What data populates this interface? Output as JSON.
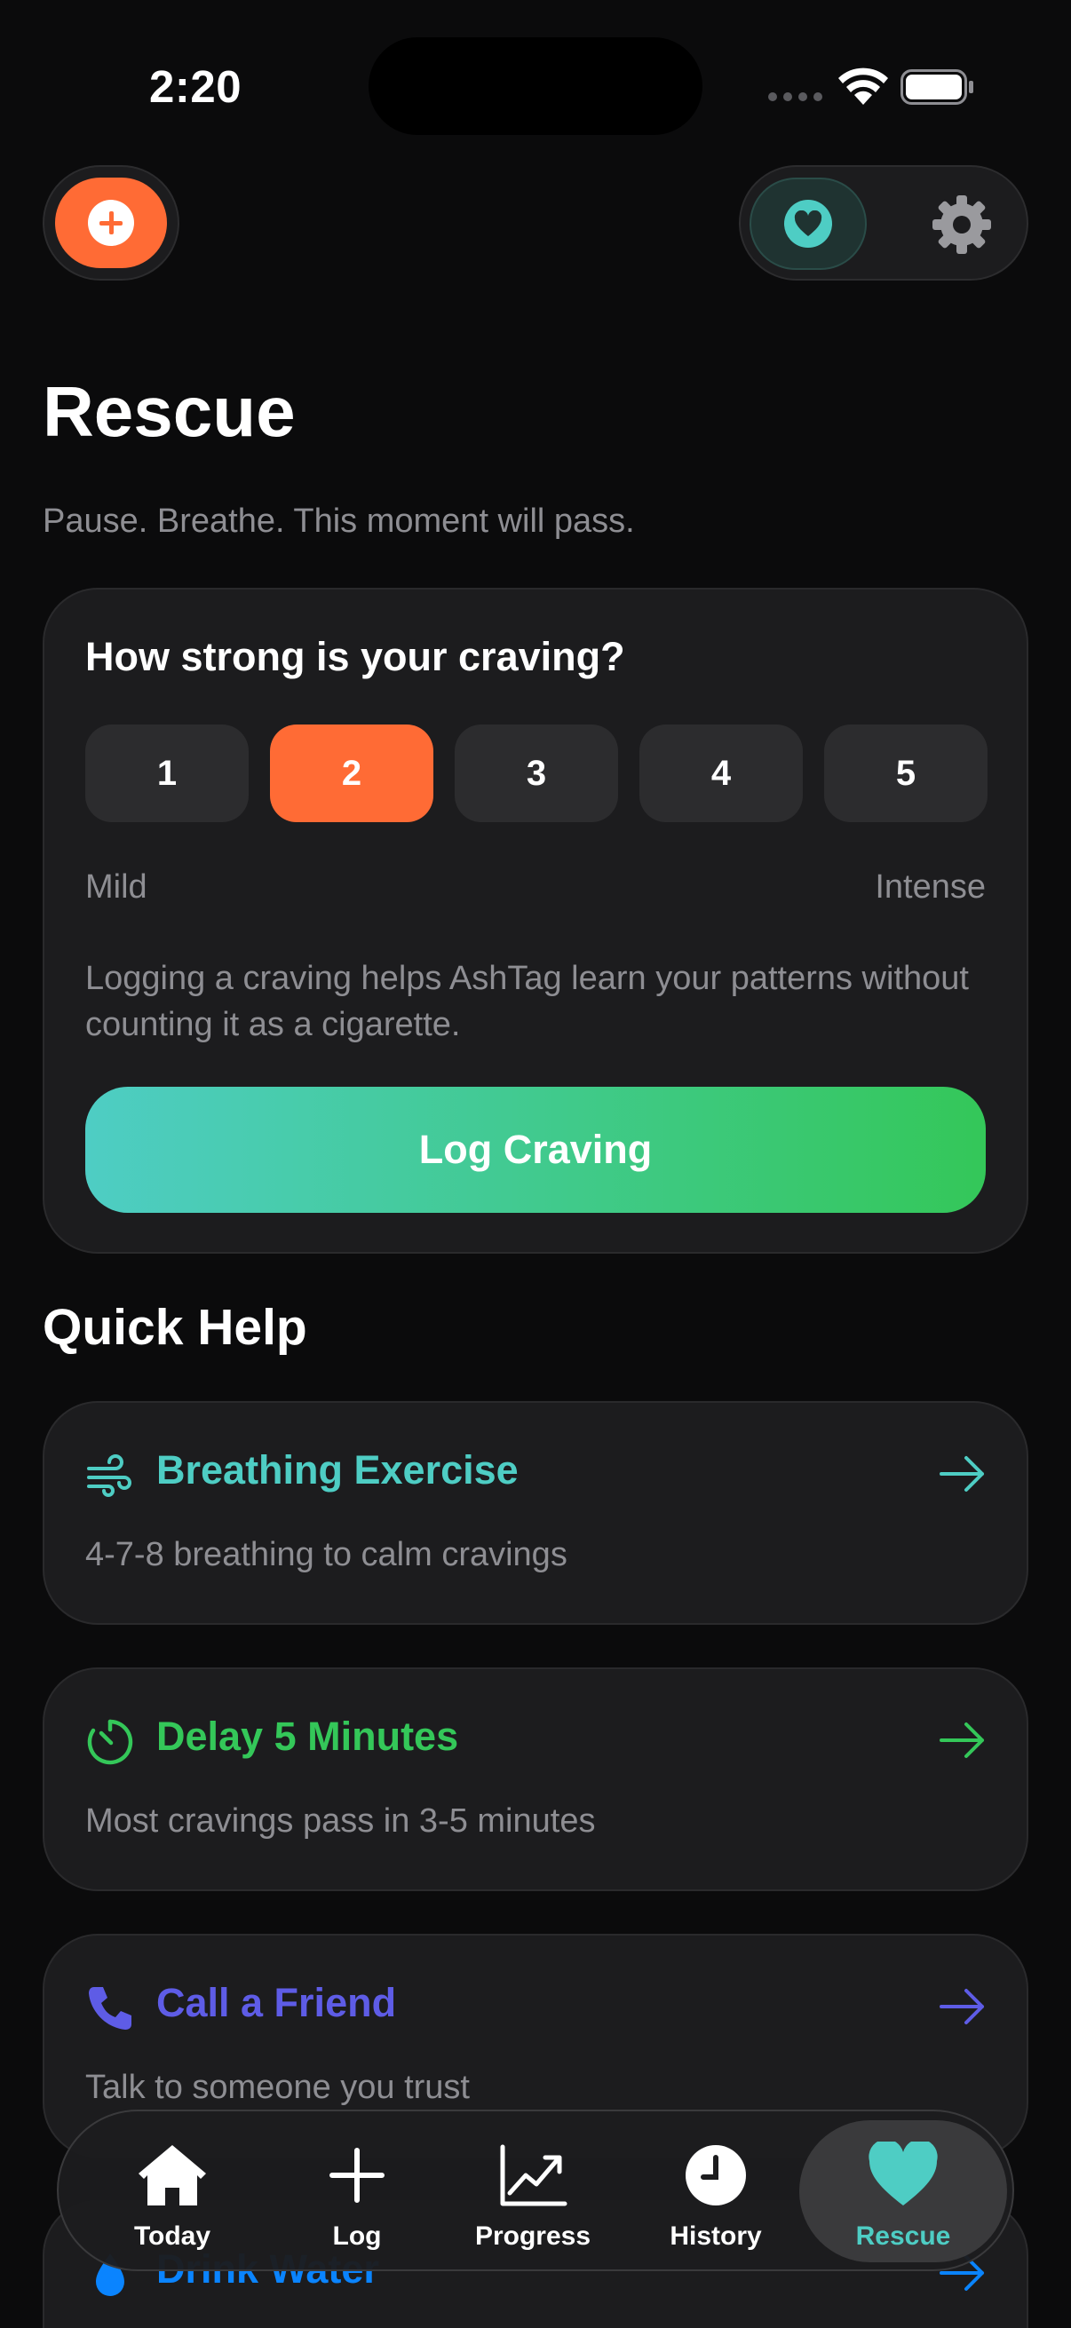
{
  "status": {
    "time": "2:20"
  },
  "page": {
    "title": "Rescue",
    "subtitle": "Pause. Breathe. This moment will pass."
  },
  "craving": {
    "question": "How strong is your craving?",
    "levels": [
      "1",
      "2",
      "3",
      "4",
      "5"
    ],
    "selected": "2",
    "scale_low": "Mild",
    "scale_high": "Intense",
    "note": "Logging a craving helps AshTag learn your patterns without counting it as a cigarette.",
    "button": "Log Craving"
  },
  "quick_help": {
    "heading": "Quick Help",
    "items": [
      {
        "title": "Breathing Exercise",
        "desc": "4-7-8 breathing to calm cravings",
        "color": "#4ecdc4",
        "icon": "wind-icon"
      },
      {
        "title": "Delay 5 Minutes",
        "desc": "Most cravings pass in 3-5 minutes",
        "color": "#34c759",
        "icon": "timer-icon"
      },
      {
        "title": "Call a Friend",
        "desc": "Talk to someone you trust",
        "color": "#5e5ce6",
        "icon": "phone-icon"
      },
      {
        "title": "Drink Water",
        "desc": "",
        "color": "#0a84ff",
        "icon": "water-drop-icon"
      }
    ]
  },
  "tabbar": {
    "tabs": [
      {
        "label": "Today",
        "icon": "house-icon"
      },
      {
        "label": "Log",
        "icon": "plus-icon"
      },
      {
        "label": "Progress",
        "icon": "chart-icon"
      },
      {
        "label": "History",
        "icon": "clock-icon"
      },
      {
        "label": "Rescue",
        "icon": "heart-icon",
        "active": true
      }
    ]
  },
  "colors": {
    "accent_orange": "#ff6b35",
    "accent_teal": "#4ecdc4",
    "accent_green": "#34c759",
    "accent_purple": "#5e5ce6"
  }
}
